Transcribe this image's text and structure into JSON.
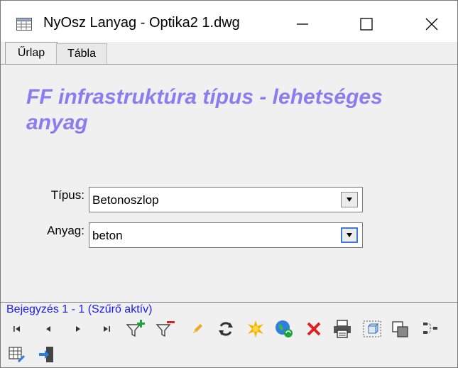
{
  "window": {
    "title": "NyOsz Lanyag - Optika2 1.dwg"
  },
  "tabs": [
    {
      "label": "Űrlap",
      "active": true
    },
    {
      "label": "Tábla",
      "active": false
    }
  ],
  "form": {
    "title": "FF infrastruktúra típus - lehetséges anyag",
    "fields": [
      {
        "label": "Típus:",
        "value": "Betonoszlop"
      },
      {
        "label": "Anyag:",
        "value": "beton"
      }
    ]
  },
  "status": {
    "text": "Bejegyzés 1 - 1 (Szűrő aktív)"
  },
  "toolbar": {
    "icons": [
      "first-record-icon",
      "previous-record-icon",
      "next-record-icon",
      "last-record-icon",
      "filter-add-icon",
      "filter-remove-icon",
      "edit-pencil-icon",
      "refresh-icon",
      "new-record-icon",
      "web-refresh-icon",
      "delete-icon",
      "print-icon",
      "select-object-icon",
      "copy-object-icon",
      "network-icon",
      "table-edit-icon",
      "exit-icon"
    ]
  },
  "colors": {
    "title_accent": "#8a7df0",
    "status_text": "#1a1af0",
    "focus_border": "#3d7bd6",
    "delete_red": "#e02020",
    "add_green": "#1aa83a"
  }
}
